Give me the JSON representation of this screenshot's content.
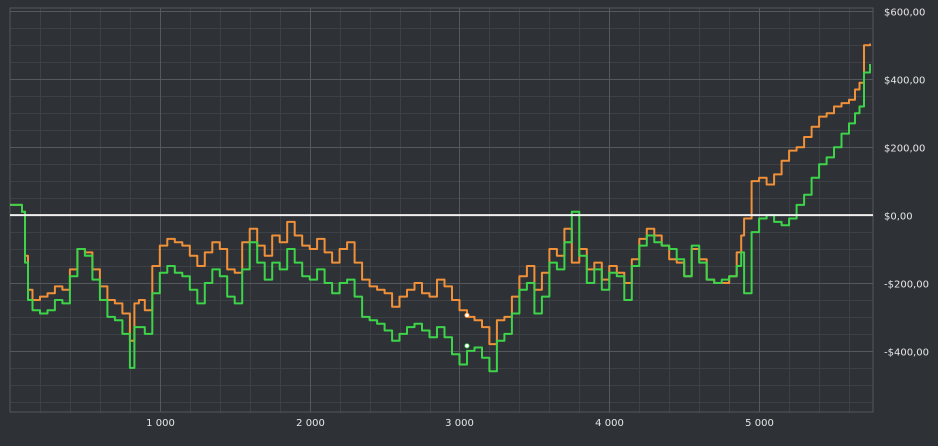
{
  "chart_data": {
    "type": "line",
    "title": "",
    "xlabel": "",
    "ylabel": "",
    "xlim": [
      0,
      5760
    ],
    "ylim": [
      -580,
      610
    ],
    "x_ticks": [
      1000,
      2000,
      3000,
      4000,
      5000
    ],
    "x_tick_labels": [
      "1 000",
      "2 000",
      "3 000",
      "4 000",
      "5 000"
    ],
    "y_ticks": [
      600,
      400,
      200,
      0,
      -200,
      -400
    ],
    "y_tick_labels": [
      "$600,00",
      "$400,00",
      "$200,00",
      "$0,00",
      "-$200,00",
      "-$400,00"
    ],
    "y_axis_position": "right",
    "grid": true,
    "minor_grid": true,
    "legend": "none",
    "colors": {
      "background": "#2e3136",
      "grid_major": "#55585d",
      "grid_minor": "#3d4045",
      "zero_line": "#f0f0f0",
      "text": "#e6e6e6"
    },
    "zero_line": 0,
    "series": [
      {
        "color": "#f0913a",
        "x": [
          0,
          50,
          80,
          100,
          120,
          150,
          200,
          250,
          300,
          350,
          400,
          450,
          500,
          550,
          600,
          650,
          700,
          750,
          800,
          830,
          860,
          900,
          950,
          1000,
          1050,
          1100,
          1150,
          1200,
          1250,
          1300,
          1350,
          1400,
          1450,
          1500,
          1550,
          1600,
          1650,
          1700,
          1750,
          1800,
          1850,
          1900,
          1950,
          2000,
          2050,
          2100,
          2150,
          2200,
          2250,
          2300,
          2350,
          2400,
          2450,
          2500,
          2550,
          2600,
          2650,
          2700,
          2750,
          2800,
          2850,
          2900,
          2950,
          3000,
          3050,
          3100,
          3150,
          3200,
          3250,
          3300,
          3350,
          3400,
          3450,
          3500,
          3550,
          3600,
          3650,
          3700,
          3750,
          3800,
          3850,
          3900,
          3950,
          4000,
          4050,
          4100,
          4150,
          4200,
          4250,
          4300,
          4350,
          4400,
          4450,
          4500,
          4550,
          4600,
          4650,
          4700,
          4750,
          4800,
          4850,
          4880,
          4900,
          4950,
          5000,
          5050,
          5100,
          5150,
          5200,
          5250,
          5300,
          5350,
          5400,
          5450,
          5500,
          5550,
          5600,
          5640,
          5670,
          5700,
          5740
        ],
        "values": [
          30,
          30,
          10,
          -120,
          -220,
          -250,
          -240,
          -230,
          -210,
          -220,
          -160,
          -100,
          -110,
          -160,
          -210,
          -250,
          -260,
          -290,
          -370,
          -260,
          -250,
          -280,
          -150,
          -90,
          -70,
          -80,
          -90,
          -120,
          -150,
          -110,
          -80,
          -100,
          -160,
          -170,
          -80,
          -40,
          -90,
          -120,
          -60,
          -80,
          -20,
          -60,
          -90,
          -100,
          -70,
          -110,
          -140,
          -100,
          -80,
          -140,
          -190,
          -210,
          -220,
          -230,
          -270,
          -240,
          -220,
          -200,
          -230,
          -240,
          -190,
          -210,
          -250,
          -280,
          -300,
          -310,
          -330,
          -380,
          -310,
          -300,
          -240,
          -180,
          -150,
          -220,
          -170,
          -100,
          -120,
          -40,
          -140,
          -100,
          -160,
          -140,
          -190,
          -150,
          -170,
          -200,
          -130,
          -70,
          -40,
          -60,
          -90,
          -130,
          -140,
          -180,
          -100,
          -130,
          -190,
          -200,
          -200,
          -180,
          -110,
          -60,
          -10,
          100,
          110,
          90,
          120,
          160,
          190,
          200,
          230,
          260,
          290,
          300,
          320,
          330,
          340,
          370,
          390,
          500,
          505
        ],
        "markers": [
          {
            "x": 3050,
            "y": -295
          }
        ]
      },
      {
        "color": "#3dd44a",
        "x": [
          0,
          50,
          80,
          100,
          120,
          150,
          200,
          250,
          300,
          350,
          400,
          450,
          500,
          550,
          600,
          650,
          700,
          750,
          800,
          830,
          860,
          900,
          950,
          1000,
          1050,
          1100,
          1150,
          1200,
          1250,
          1300,
          1350,
          1400,
          1450,
          1500,
          1550,
          1600,
          1650,
          1700,
          1750,
          1800,
          1850,
          1900,
          1950,
          2000,
          2050,
          2100,
          2150,
          2200,
          2250,
          2300,
          2350,
          2400,
          2450,
          2500,
          2550,
          2600,
          2650,
          2700,
          2750,
          2800,
          2850,
          2900,
          2950,
          3000,
          3050,
          3100,
          3150,
          3200,
          3250,
          3300,
          3350,
          3400,
          3450,
          3500,
          3550,
          3600,
          3650,
          3700,
          3750,
          3800,
          3850,
          3900,
          3950,
          4000,
          4050,
          4100,
          4150,
          4200,
          4250,
          4300,
          4350,
          4400,
          4450,
          4500,
          4550,
          4600,
          4650,
          4700,
          4750,
          4800,
          4850,
          4880,
          4900,
          4950,
          5000,
          5050,
          5100,
          5150,
          5200,
          5250,
          5300,
          5350,
          5400,
          5450,
          5500,
          5550,
          5600,
          5640,
          5670,
          5700,
          5740
        ],
        "values": [
          30,
          30,
          10,
          -140,
          -250,
          -280,
          -290,
          -280,
          -250,
          -260,
          -180,
          -100,
          -120,
          -190,
          -250,
          -300,
          -310,
          -350,
          -450,
          -330,
          -330,
          -350,
          -230,
          -170,
          -150,
          -170,
          -180,
          -220,
          -260,
          -200,
          -160,
          -180,
          -240,
          -260,
          -160,
          -80,
          -140,
          -190,
          -140,
          -160,
          -100,
          -140,
          -180,
          -190,
          -160,
          -200,
          -230,
          -200,
          -190,
          -240,
          -300,
          -310,
          -320,
          -340,
          -370,
          -350,
          -330,
          -320,
          -340,
          -360,
          -330,
          -360,
          -410,
          -440,
          -400,
          -390,
          -420,
          -460,
          -370,
          -350,
          -290,
          -220,
          -200,
          -290,
          -240,
          -140,
          -160,
          -80,
          10,
          -120,
          -200,
          -160,
          -220,
          -170,
          -180,
          -250,
          -150,
          -90,
          -60,
          -80,
          -90,
          -100,
          -130,
          -180,
          -90,
          -140,
          -190,
          -200,
          -190,
          -180,
          -150,
          -110,
          -230,
          -50,
          -10,
          0,
          -20,
          -30,
          -10,
          30,
          60,
          110,
          150,
          170,
          200,
          240,
          270,
          300,
          320,
          420,
          445
        ],
        "markers": [
          {
            "x": 3050,
            "y": -385
          }
        ]
      }
    ]
  }
}
